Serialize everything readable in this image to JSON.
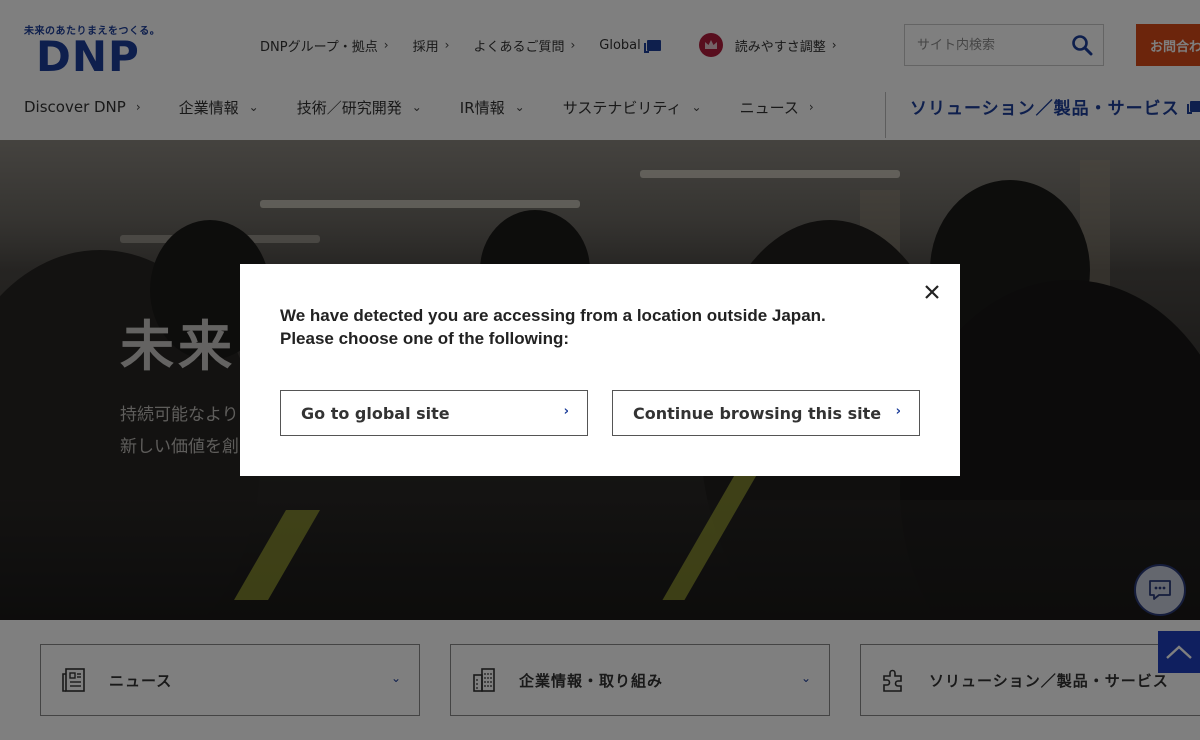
{
  "header": {
    "logo": {
      "tagline": "未来のあたりまえをつくる。",
      "mark": "DNP"
    },
    "utility": [
      {
        "label": "DNPグループ・拠点"
      },
      {
        "label": "採用"
      },
      {
        "label": "よくあるご質問"
      },
      {
        "label": "Global"
      }
    ],
    "readability_label": "読みやすさ調整",
    "search": {
      "placeholder": "サイト内検索"
    },
    "contact_label": "お問合わせ",
    "nav": [
      {
        "label": "Discover DNP"
      },
      {
        "label": "企業情報"
      },
      {
        "label": "技術／研究開発"
      },
      {
        "label": "IR情報"
      },
      {
        "label": "サステナビリティ"
      },
      {
        "label": "ニュース"
      }
    ],
    "solutions_label": "ソリューション／製品・サービス"
  },
  "hero": {
    "title": "未来",
    "sub1": "持続可能なより",
    "sub2": "新しい価値を創"
  },
  "cards": [
    {
      "label": "ニュース"
    },
    {
      "label": "企業情報・取り組み"
    },
    {
      "label": "ソリューション／製品・サービス"
    }
  ],
  "modal": {
    "message_line1": "We have detected you are accessing from a location outside Japan.",
    "message_line2": "Please choose one of the following:",
    "global_button": "Go to global site",
    "continue_button": "Continue browsing this site"
  },
  "colors": {
    "brand_blue": "#1d3e9a",
    "contact_orange": "#d84a19",
    "crown_red": "#b01c3d",
    "top_button_blue": "#1f3fbf"
  }
}
